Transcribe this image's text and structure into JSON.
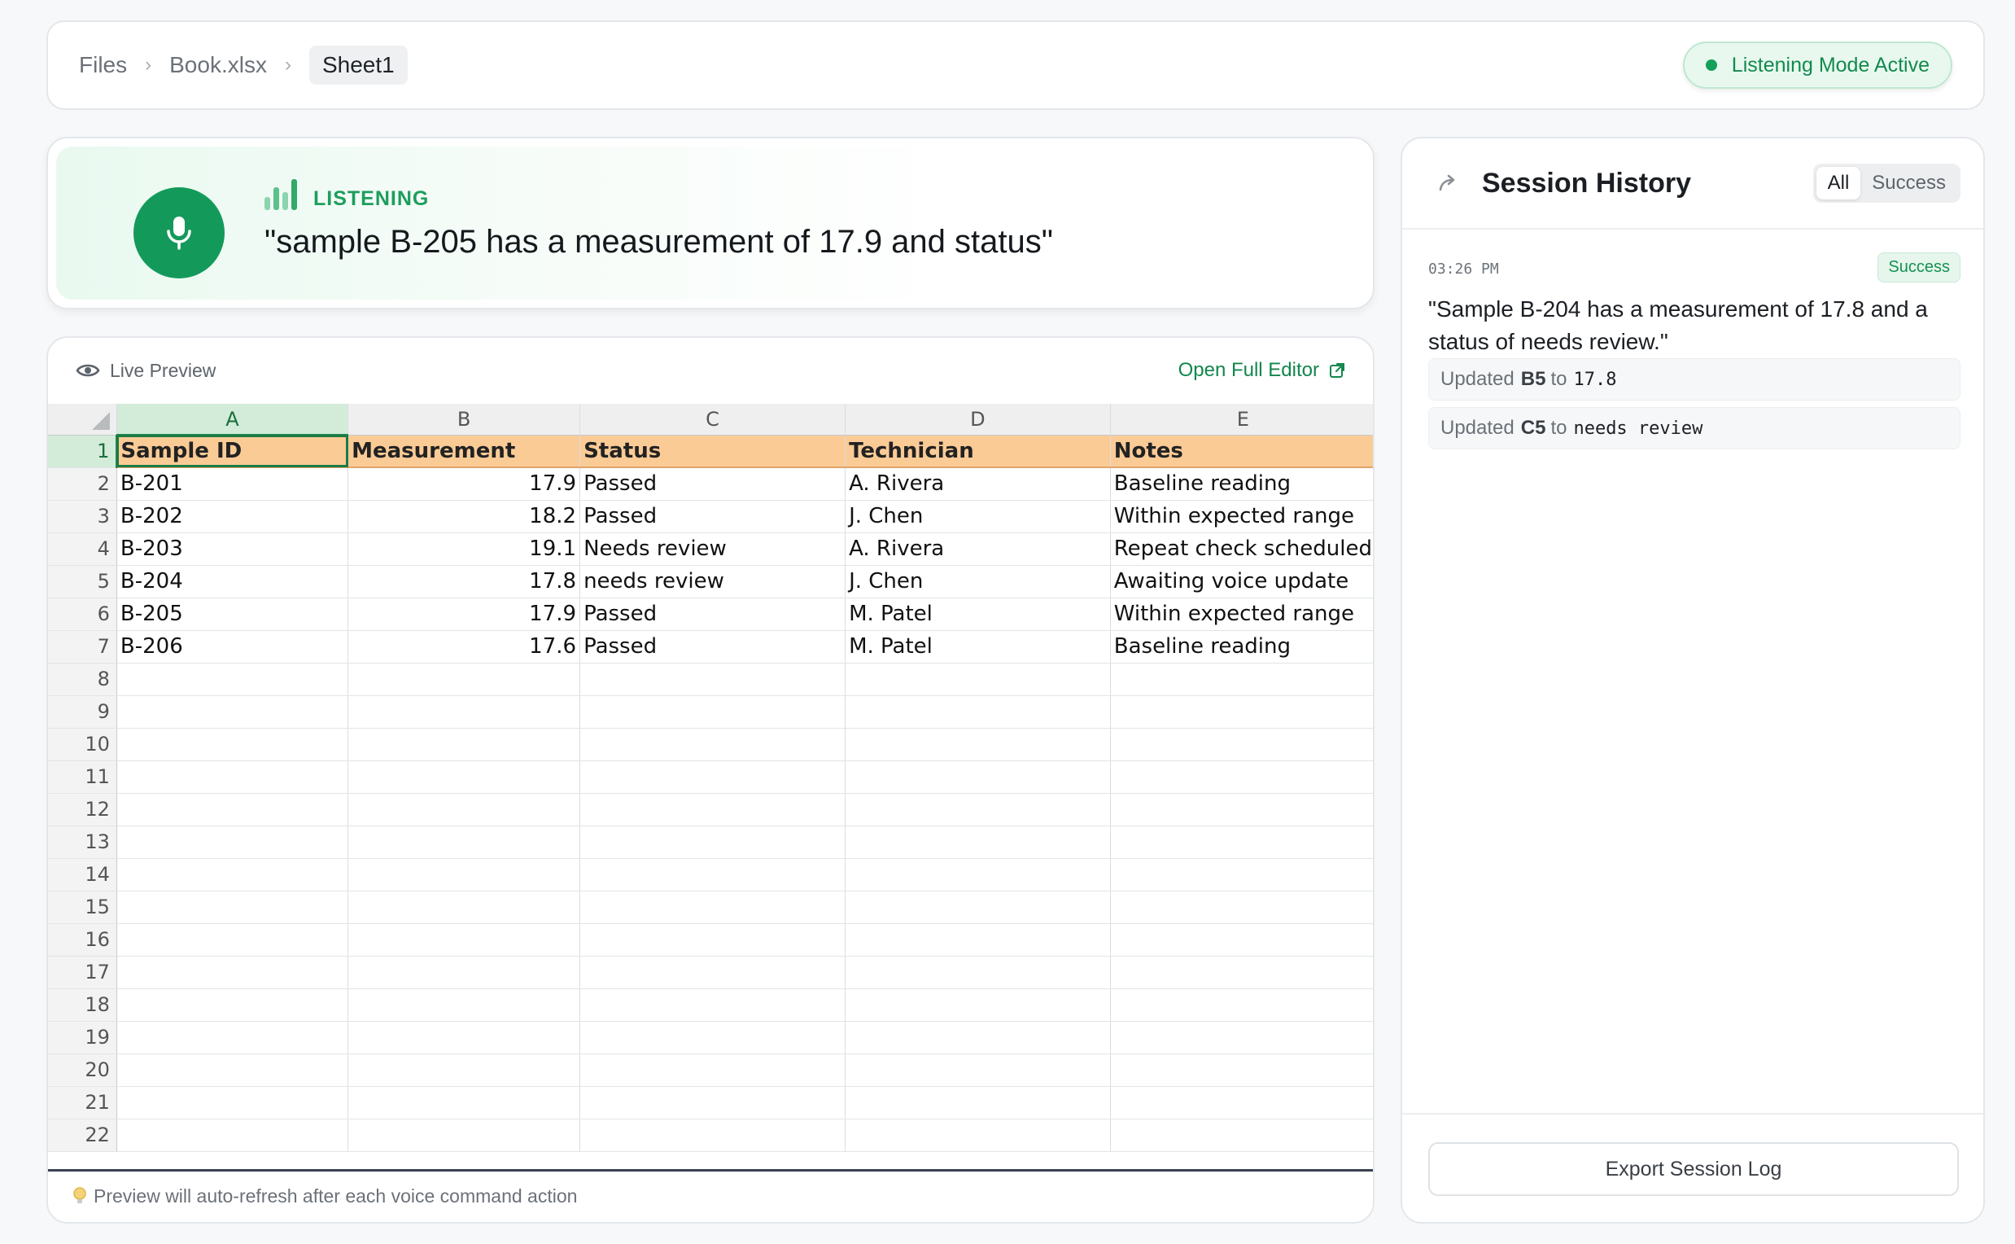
{
  "breadcrumb": {
    "items": [
      "Files",
      "Book.xlsx",
      "Sheet1"
    ],
    "separator": "›"
  },
  "status_badge": {
    "label": "Listening Mode Active",
    "color": "#12a05a"
  },
  "listening": {
    "label": "LISTENING",
    "transcript": "\"sample B-205 has a measurement of 17.9 and status\""
  },
  "preview": {
    "title": "Live Preview",
    "open_editor_label": "Open Full Editor",
    "footer_note": "Preview will auto-refresh after each voice command action"
  },
  "spreadsheet": {
    "columns": [
      "A",
      "B",
      "C",
      "D",
      "E"
    ],
    "headers": [
      "Sample ID",
      "Measurement",
      "Status",
      "Technician",
      "Notes"
    ],
    "rows": [
      [
        "B-201",
        "17.9",
        "Passed",
        "A. Rivera",
        "Baseline reading"
      ],
      [
        "B-202",
        "18.2",
        "Passed",
        "J. Chen",
        "Within expected range"
      ],
      [
        "B-203",
        "19.1",
        "Needs review",
        "A. Rivera",
        "Repeat check scheduled"
      ],
      [
        "B-204",
        "17.8",
        "needs review",
        "J. Chen",
        "Awaiting voice update"
      ],
      [
        "B-205",
        "17.9",
        "Passed",
        "M. Patel",
        "Within expected range"
      ],
      [
        "B-206",
        "17.6",
        "Passed",
        "M. Patel",
        "Baseline reading"
      ]
    ],
    "visible_row_numbers": [
      "1",
      "2",
      "3",
      "4",
      "5",
      "6",
      "7",
      "8",
      "9",
      "10",
      "11",
      "12",
      "13",
      "14",
      "15",
      "16",
      "17",
      "18",
      "19",
      "20",
      "21",
      "22"
    ],
    "active_cell": "A1",
    "header_fill": "#fbcb96"
  },
  "history": {
    "title": "Session History",
    "filters": [
      "All",
      "Success"
    ],
    "active_filter": "All",
    "entries": [
      {
        "time": "03:26 PM",
        "status": "Success",
        "text": "\"Sample B-204 has a measurement of 17.8 and a status of needs review.\"",
        "updates": [
          {
            "prefix": "Updated",
            "cell": "B5",
            "to": "to",
            "value": "17.8"
          },
          {
            "prefix": "Updated",
            "cell": "C5",
            "to": "to",
            "value": "needs review"
          }
        ]
      }
    ],
    "export_label": "Export Session Log"
  },
  "icons": {
    "mic": "microphone-icon",
    "bars": "audio-level-icon",
    "eye": "eye-icon",
    "external": "external-link-icon",
    "bulb": "lightbulb-icon",
    "share": "share-arrow-icon"
  }
}
